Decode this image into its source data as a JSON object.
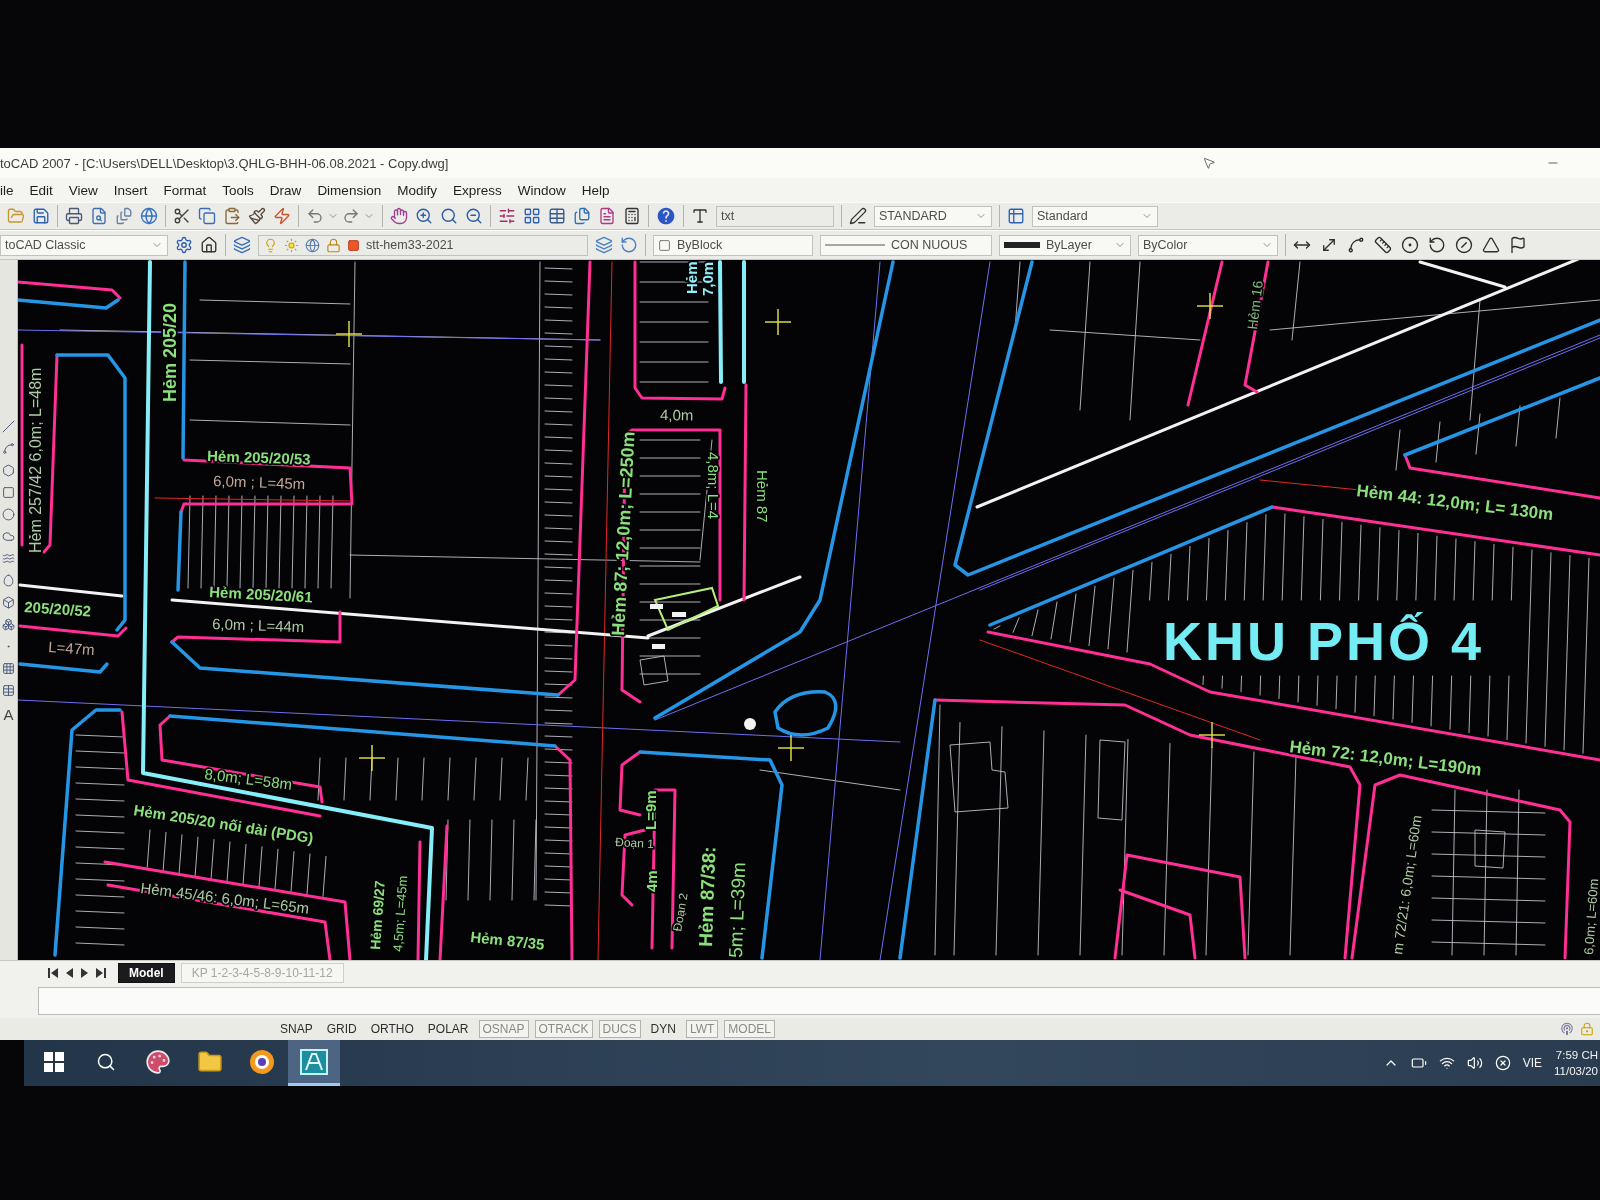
{
  "window": {
    "title": "toCAD 2007 - [C:\\Users\\DELL\\Desktop\\3.QHLG-BHH-06.08.2021 - Copy.dwg]"
  },
  "menu": [
    "ile",
    "Edit",
    "View",
    "Insert",
    "Format",
    "Tools",
    "Draw",
    "Dimension",
    "Modify",
    "Express",
    "Window",
    "Help"
  ],
  "toolbars": {
    "text_style": "txt",
    "dimension_style": "STANDARD",
    "table_style": "Standard",
    "workspace": "toCAD Classic",
    "layer": "stt-hem33-2021",
    "color_setting": "ByBlock",
    "linetype": "CON NUOUS",
    "lineweight": "ByLayer",
    "plot_style": "ByColor"
  },
  "left_toolbar": {
    "text_tool": "A"
  },
  "drawing": {
    "labels": [
      "Hẻm 205/20",
      "Hẻm 257/42 6,0m; L=48m",
      "Hẻm 205/20/53",
      "6,0m ; L=45m",
      "205/20/52",
      "L=47m",
      "Hẻm 205/20/61",
      "6,0m ; L=44m",
      "8,0m; L=58m",
      "Hẻm 205/20 nối dài (PDG)",
      "Hẻm 45/46: 6,0m; L=65m",
      "Hẻm 69/27",
      "4,5m; L=45m",
      "Hẻm 87/35",
      "Hẻm 87; 12,0m; L=250m",
      "Hẻm",
      "7,0m",
      "4,0m",
      "4,8m; L=4",
      "Hẻm 87",
      "L=9m",
      "Đoạn 1",
      "4m",
      "Đoạn 2",
      "Hẻm 87/38:",
      "5m; L=39m",
      "Hẻm 16",
      "Hẻm 44: 12,0m; L= 130m",
      "Hẻm 72: 12,0m; L=190m",
      "m 72/21: 6,0m; L=60m",
      "6,0m; L=60m"
    ],
    "area_name": "KHU PHỐ 4"
  },
  "layout_tabs": [
    {
      "label": "Model",
      "selected": true
    },
    {
      "label": "KP 1-2-3-4-5-8-9-10-11-12",
      "selected": false
    }
  ],
  "status_toggles": [
    {
      "label": "SNAP",
      "on": false
    },
    {
      "label": "GRID",
      "on": false
    },
    {
      "label": "ORTHO",
      "on": false
    },
    {
      "label": "POLAR",
      "on": false
    },
    {
      "label": "OSNAP",
      "on": true
    },
    {
      "label": "OTRACK",
      "on": true
    },
    {
      "label": "DUCS",
      "on": true
    },
    {
      "label": "DYN",
      "on": false
    },
    {
      "label": "LWT",
      "on": true
    },
    {
      "label": "MODEL",
      "on": true
    }
  ],
  "taskbar": {
    "apps": [
      {
        "kind": "paint",
        "selected": false
      },
      {
        "kind": "folder",
        "selected": false
      },
      {
        "kind": "browser",
        "selected": false
      },
      {
        "kind": "cad",
        "selected": true
      }
    ],
    "language": "VIE",
    "time": "7:59 CH",
    "date": "11/03/20"
  }
}
